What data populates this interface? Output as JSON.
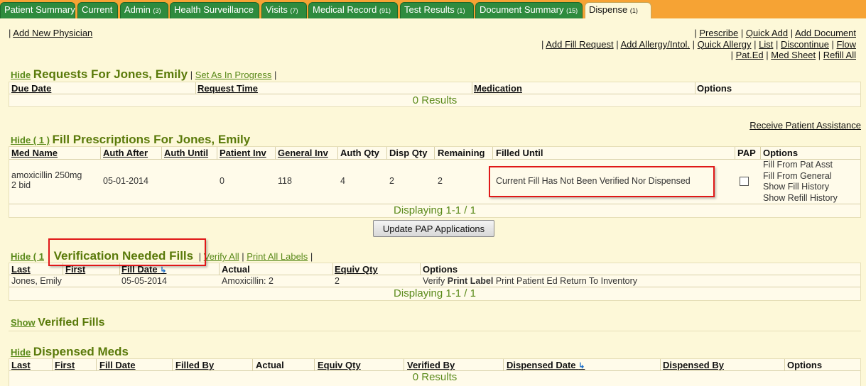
{
  "tabs": [
    {
      "label": "Patient Summary",
      "count": ""
    },
    {
      "label": "Current",
      "count": ""
    },
    {
      "label": "Admin",
      "count": "(3)"
    },
    {
      "label": "Health Surveillance",
      "count": ""
    },
    {
      "label": "Visits",
      "count": "(7)"
    },
    {
      "label": "Medical Record",
      "count": "(91)"
    },
    {
      "label": "Test Results",
      "count": "(1)"
    },
    {
      "label": "Document Summary",
      "count": "(15)"
    },
    {
      "label": "Dispense",
      "count": "(1)"
    }
  ],
  "top_left_link": "Add New Physician",
  "top_right_links": {
    "row1": [
      "Prescribe",
      "Quick Add",
      "Add Document"
    ],
    "row2": [
      "Add Fill Request",
      "Add Allergy/Intol.",
      "Quick Allergy",
      "List",
      "Discontinue",
      "Flow"
    ],
    "row3": [
      "Pat.Ed",
      "Med Sheet",
      "Refill All"
    ]
  },
  "requests": {
    "hide_label": "Hide",
    "title": "Requests For Jones, Emily",
    "action": "Set As In Progress",
    "columns": [
      "Due Date",
      "Request Time",
      "Medication",
      "Options"
    ],
    "results": "0 Results"
  },
  "receive_assistance": "Receive Patient Assistance",
  "fill": {
    "hide_label": "Hide ( 1 )",
    "title": "Fill Prescriptions For Jones, Emily",
    "columns": [
      "Med Name",
      "Auth After",
      "Auth Until",
      "Patient Inv",
      "General Inv",
      "Auth Qty",
      "Disp Qty",
      "Remaining",
      "Filled Until",
      "PAP",
      "Options"
    ],
    "row": {
      "med_name_line1": "amoxicillin 250mg",
      "med_name_line2": "2 bid",
      "auth_after": "05-01-2014",
      "auth_until": "",
      "patient_inv": "0",
      "general_inv": "118",
      "auth_qty": "4",
      "disp_qty": "2",
      "remaining": "2",
      "filled_until": "Current Fill Has Not Been Verified Nor Dispensed",
      "options": [
        "Fill From Pat Asst",
        "Fill From General",
        "Show Fill History",
        "Show Refill History"
      ]
    },
    "displaying": "Displaying 1-1 / 1",
    "button": "Update PAP Applications"
  },
  "verification": {
    "hide_label": "Hide ( 1",
    "title": "Verification Needed Fills",
    "actions": [
      "Verify All",
      "Print All Labels"
    ],
    "columns": [
      "Last",
      "First",
      "Fill Date",
      "Actual",
      "Equiv Qty",
      "Options"
    ],
    "row": {
      "last": "Jones, Emily",
      "first": "",
      "fill_date": "05-05-2014",
      "actual": "Amoxicillin: 2",
      "equiv_qty": "2",
      "opt_verify": "Verify",
      "opt_print_label": "Print Label",
      "opt_print_ed": "Print Patient Ed",
      "opt_return": "Return To Inventory"
    },
    "displaying": "Displaying 1-1 / 1"
  },
  "verified": {
    "show_label": "Show",
    "title": "Verified Fills"
  },
  "dispensed": {
    "hide_label": "Hide",
    "title": "Dispensed Meds",
    "columns": [
      "Last",
      "First",
      "Fill Date",
      "Filled By",
      "Actual",
      "Equiv Qty",
      "Verified By",
      "Dispensed Date",
      "Dispensed By",
      "Options"
    ],
    "results": "0 Results"
  }
}
